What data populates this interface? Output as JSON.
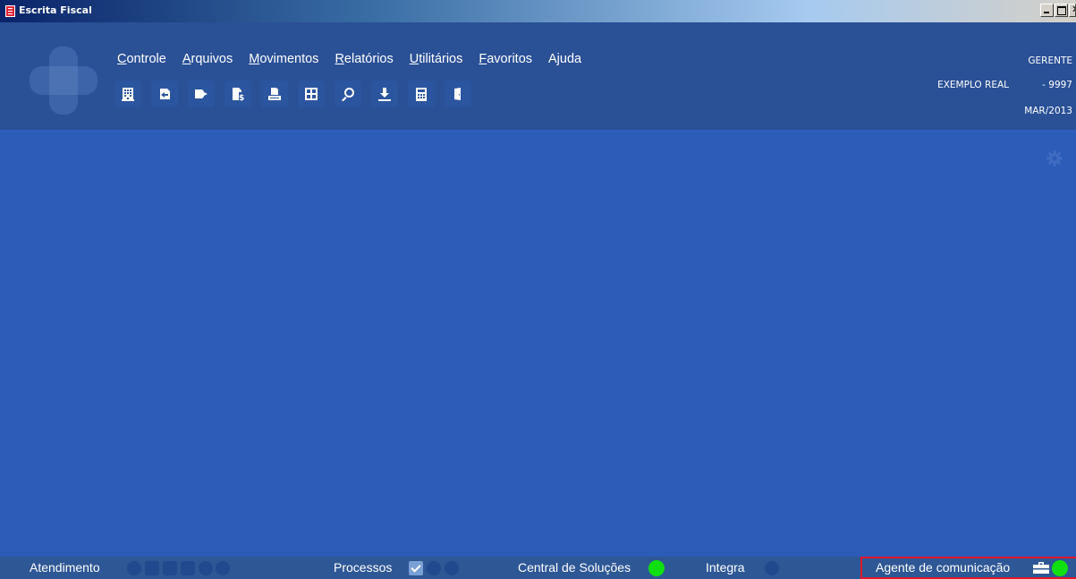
{
  "window": {
    "title": "Escrita Fiscal"
  },
  "menu": [
    {
      "label": "Controle",
      "mnemonic": "C",
      "rest": "ontrole"
    },
    {
      "label": "Arquivos",
      "mnemonic": "A",
      "rest": "rquivos"
    },
    {
      "label": "Movimentos",
      "mnemonic": "M",
      "rest": "ovimentos"
    },
    {
      "label": "Relatórios",
      "mnemonic": "R",
      "rest": "elatórios"
    },
    {
      "label": "Utilitários",
      "mnemonic": "U",
      "rest": "tilitários"
    },
    {
      "label": "Favoritos",
      "mnemonic": "F",
      "rest": "avoritos"
    },
    {
      "label": "Ajuda",
      "mnemonic": "",
      "rest": "Ajuda"
    }
  ],
  "toolbar_icons": [
    "building-icon",
    "entry-icon",
    "exit-icon",
    "tax-document-icon",
    "print-icon",
    "calculation-icon",
    "search-icon",
    "download-icon",
    "calculator-icon",
    "door-exit-icon"
  ],
  "session": {
    "user": "GERENTE",
    "company_name": "EXEMPLO REAL",
    "company_code": "- 9997",
    "period": "MAR/2013"
  },
  "statusbar": {
    "atendimento": "Atendimento",
    "processos": "Processos",
    "central": "Central de Soluções",
    "integra": "Integra",
    "agente": "Agente de comunicação"
  },
  "colors": {
    "background": "#2b5cb8",
    "header": "#2a5096",
    "status_ok": "#10e010",
    "highlight_border": "#e0182a"
  }
}
